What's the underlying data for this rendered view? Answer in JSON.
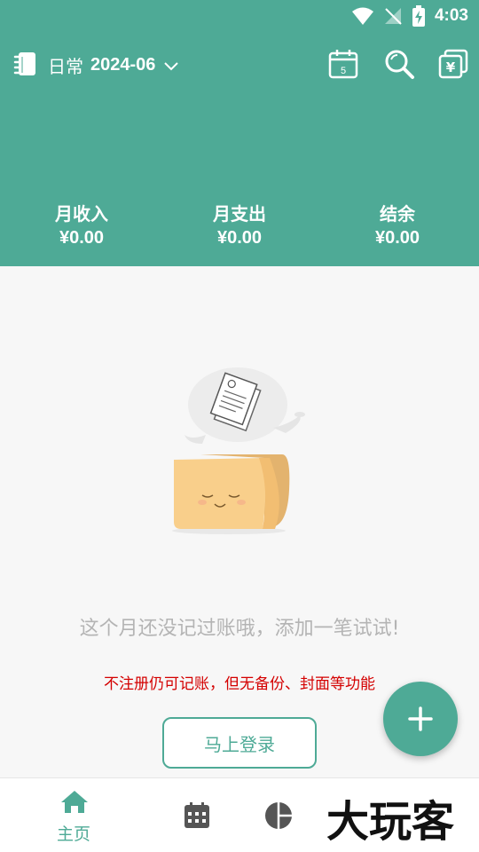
{
  "status_bar": {
    "time": "4:03"
  },
  "toolbar": {
    "book_name": "日常",
    "month": "2024-06",
    "calendar_day": "5",
    "currency_icon_glyph": "¥"
  },
  "summary": {
    "income_label": "月收入",
    "income_value": "¥0.00",
    "expense_label": "月支出",
    "expense_value": "¥0.00",
    "balance_label": "结余",
    "balance_value": "¥0.00"
  },
  "empty_state": {
    "message": "这个月还没记过账哦，添加一笔试试!",
    "warning": "不注册仍可记账，但无备份、封面等功能",
    "login_label": "马上登录"
  },
  "bottom_nav": {
    "home_label": "主页"
  },
  "watermark": {
    "text": "大玩客"
  },
  "colors": {
    "primary": "#4eaa96",
    "warning": "#d40000",
    "muted_text": "#b4b4b4",
    "background": "#f7f7f7"
  },
  "icons": [
    "wifi-icon",
    "no-signal-icon",
    "battery-charging-icon",
    "notebook-icon",
    "chevron-down-icon",
    "calendar-icon",
    "search-icon",
    "currency-cards-icon",
    "plus-icon",
    "home-icon",
    "calendar-grid-icon",
    "pie-chart-icon"
  ]
}
